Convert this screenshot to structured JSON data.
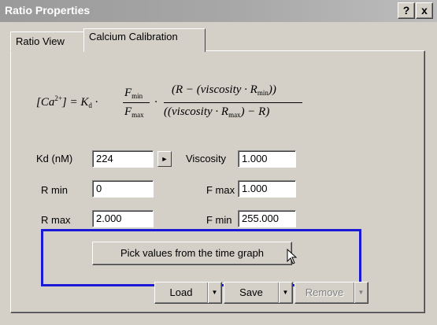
{
  "window": {
    "title": "Ratio Properties",
    "help_label": "?",
    "close_label": "x"
  },
  "tabs": [
    {
      "label": "Ratio View",
      "selected": false
    },
    {
      "label": "Calcium Calibration",
      "selected": true
    }
  ],
  "equation": {
    "lhs": "[Ca",
    "lhs_sup": "2+",
    "lhs_close": "] = K",
    "lhs_sub": "d",
    "dot1": "·",
    "f_min": "F",
    "f_min_sub": "min",
    "f_max": "F",
    "f_max_sub": "max",
    "dot2": "·",
    "num": "(R − (viscosity · R",
    "num_sub": "min",
    "num_close": "))",
    "den": "((viscosity · R",
    "den_sub": "max",
    "den_close": ") − R)"
  },
  "form": {
    "kd_label": "Kd (nM)",
    "kd_value": "224",
    "arrow_label": "►",
    "viscosity_label": "Viscosity",
    "viscosity_value": "1.000",
    "rmin_label": "R min",
    "rmin_value": "0",
    "fmax_label": "F max",
    "fmax_value": "1.000",
    "rmax_label": "R max",
    "rmax_value": "2.000",
    "fmin_label": "F min",
    "fmin_value": "255.000"
  },
  "buttons": {
    "pick_label": "Pick values from the time graph",
    "load_label": "Load",
    "save_label": "Save",
    "remove_label": "Remove",
    "dropdown_glyph": "▼"
  },
  "colors": {
    "highlight": "#1a1ad6",
    "dialog_bg": "#d4d0c8"
  }
}
